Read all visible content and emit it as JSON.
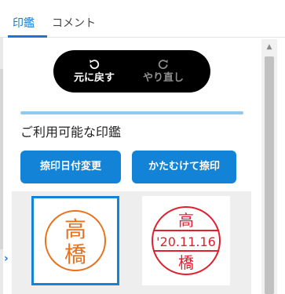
{
  "tabs": [
    {
      "label": "印鑑",
      "active": true
    },
    {
      "label": "コメント",
      "active": false
    }
  ],
  "toolbar": {
    "undo_label": "元に戻す",
    "redo_label": "やり直し"
  },
  "section": {
    "title": "ご利用可能な印鑑"
  },
  "actions": {
    "change_date_label": "捺印日付変更",
    "tilted_stamp_label": "かたむけて捺印"
  },
  "stamps": [
    {
      "top": "高",
      "bottom": "橋",
      "color": "#e8711c",
      "selected": true
    },
    {
      "top": "高",
      "date": "'20.11.16",
      "bottom": "橋",
      "color": "#e0202f",
      "selected": false
    }
  ],
  "colors": {
    "accent": "#1283d6",
    "tab_active": "#1976d2",
    "toolbar_bg": "#000000"
  }
}
